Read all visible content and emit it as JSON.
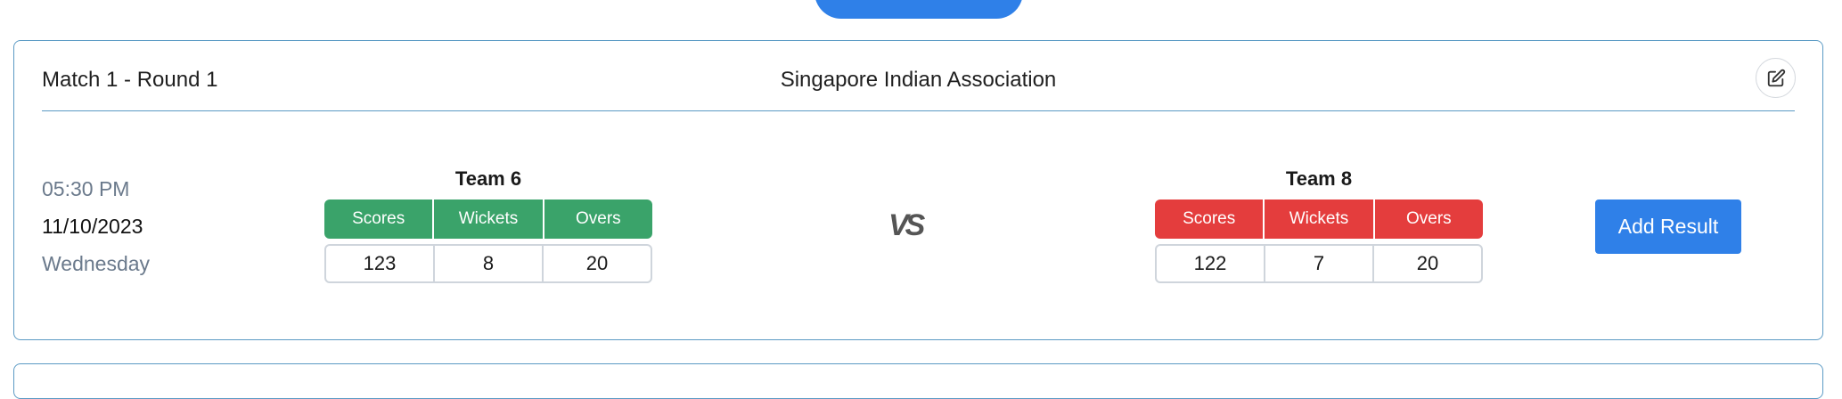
{
  "match": {
    "title": "Match 1 - Round 1",
    "venue": "Singapore Indian Association",
    "time": "05:30 PM",
    "date": "11/10/2023",
    "day": "Wednesday",
    "vs_label": "VS",
    "add_result_label": "Add Result",
    "headers": [
      "Scores",
      "Wickets",
      "Overs"
    ],
    "team1": {
      "name": "Team 6",
      "values": [
        "123",
        "8",
        "20"
      ]
    },
    "team2": {
      "name": "Team 8",
      "values": [
        "122",
        "7",
        "20"
      ]
    }
  },
  "colors": {
    "accent": "#2f80e8",
    "win": "#3aa36a",
    "loss": "#e43d3d",
    "border": "#5b9ac4"
  },
  "icons": {
    "edit": "edit-icon"
  }
}
